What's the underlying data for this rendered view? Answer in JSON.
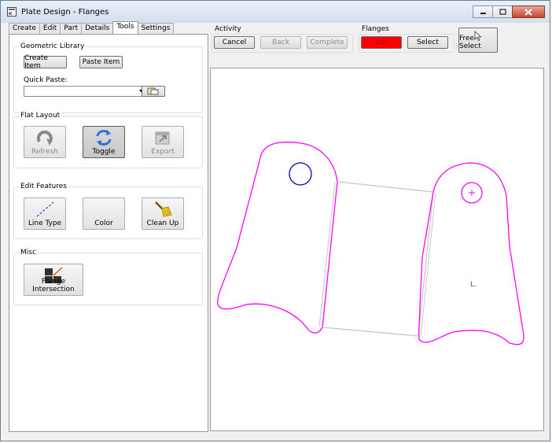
{
  "window": {
    "title": "Plate Design - Flanges"
  },
  "tabs": [
    "Create",
    "Edit",
    "Part",
    "Details",
    "Tools",
    "Settings"
  ],
  "geometric_library": {
    "label": "Geometric Library",
    "create_item": "Create Item",
    "paste_item": "Paste Item",
    "quick_paste_label": "Quick Paste:",
    "quick_paste_value": ""
  },
  "flat_layout": {
    "label": "Flat Layout",
    "refresh": "Refresh",
    "toggle": "Toggle",
    "export": "Export"
  },
  "edit_features": {
    "label": "Edit Features",
    "line_type": "Line Type",
    "color": "Color",
    "clean_up": "Clean Up"
  },
  "misc": {
    "label": "Misc",
    "flange_intersection": "Flange Intersection"
  },
  "activity": {
    "label": "Activity",
    "cancel": "Cancel",
    "back": "Back",
    "complete": "Complete"
  },
  "flanges": {
    "label": "Flanges",
    "list": "List",
    "select": "Select",
    "list_color": "#ff0000"
  },
  "free_select": "Free Select",
  "canvas": {
    "axis_marker": "L."
  },
  "colors": {
    "flange_outline": "#ff00ff",
    "hole": "#0000c0",
    "bend_lines": "#c8c8c8"
  }
}
